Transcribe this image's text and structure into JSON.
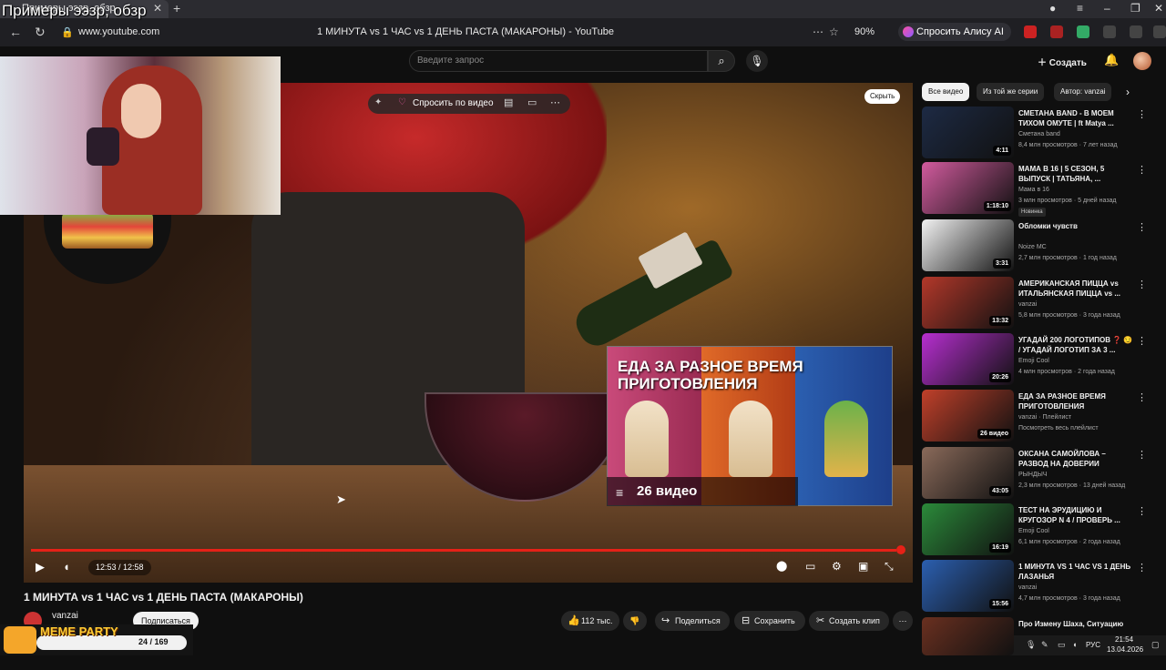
{
  "overlay_text": "Примеры ээзр, обзр",
  "browser": {
    "tab_title": "Примеры ээзр, обзр",
    "url": "www.youtube.com",
    "page_title": "1 МИНУТА vs 1 ЧАС vs 1 ДЕНЬ ПАСТА (МАКАРОНЫ) - YouTube",
    "zoom": "90%",
    "alice_label": "Спросить Алису AI"
  },
  "header": {
    "search_placeholder": "Введите запрос",
    "create_label": "Создать"
  },
  "player": {
    "ai_label": "Спросить по видео",
    "hide_label": "Скрыть",
    "time": "12:53 / 12:58",
    "progress": 0.994,
    "endcard": {
      "title": "ЕДА ЗА РАЗНОЕ ВРЕМЯ ПРИГОТОВЛЕНИЯ",
      "count": "26 видео"
    }
  },
  "video": {
    "title": "1 МИНУТА vs 1 ЧАС vs 1 ДЕНЬ ПАСТА (МАКАРОНЫ)",
    "channel": "vanzai",
    "subscribe_label": "Подписаться",
    "likes": "112 тыс.",
    "share_label": "Поделиться",
    "save_label": "Сохранить",
    "clip_label": "Создать клип"
  },
  "meme_widget": {
    "title": "MEME PARTY",
    "count": "24 / 169"
  },
  "sidebar": {
    "chips": [
      "Все видео",
      "Из той же серии",
      "Автор: vanzai"
    ],
    "items": [
      {
        "title": "СМЕТАНА BAND - В МОЕМ ТИХОМ ОМУТЕ | ft Matya ...",
        "channel": "Сметана band",
        "meta": "8,4 млн просмотров · 7 лет назад",
        "duration": "4:11",
        "badge": "",
        "thumb_color": "#1d2a44"
      },
      {
        "title": "МАМА В 16 | 5 СЕЗОН, 5 ВЫПУСК | ТАТЬЯНА, ...",
        "channel": "Мама в 16",
        "meta": "3 млн просмотров · 5 дней назад",
        "duration": "1:18:10",
        "badge": "Новинка",
        "thumb_color": "#d25b9e"
      },
      {
        "title": "Обломки чувств",
        "channel": "Noize MC",
        "meta": "2,7 млн просмотров · 1 год назад",
        "duration": "3:31",
        "badge": "",
        "thumb_color": "#f2f2f2"
      },
      {
        "title": "АМЕРИКАНСКАЯ ПИЦЦА vs ИТАЛЬЯНСКАЯ ПИЦЦА vs ...",
        "channel": "vanzai",
        "meta": "5,8 млн просмотров · 3 года назад",
        "duration": "13:32",
        "badge": "",
        "thumb_color": "#b3382a"
      },
      {
        "title": "УГАДАЙ 200 ЛОГОТИПОВ ❓ 😏 / УГАДАЙ ЛОГОТИП ЗА 3 ...",
        "channel": "Emoji Cool",
        "meta": "4 млн просмотров · 2 года назад",
        "duration": "20:26",
        "badge": "",
        "thumb_color": "#b72fd0"
      },
      {
        "title": "ЕДА ЗА РАЗНОЕ ВРЕМЯ ПРИГОТОВЛЕНИЯ",
        "channel": "vanzai · Плейлист",
        "meta": "Посмотреть весь плейлист",
        "duration": "26 видео",
        "badge": "",
        "thumb_color": "#c0402a"
      },
      {
        "title": "ОКСАНА САМОЙЛОВА – РАЗВОД НА ДОВЕРИИ",
        "channel": "РЫНДЫЧ",
        "meta": "2,3 млн просмотров · 13 дней назад",
        "duration": "43:05",
        "badge": "",
        "thumb_color": "#8a6a5a"
      },
      {
        "title": "ТЕСТ НА ЭРУДИЦИЮ И КРУГОЗОР N 4 / ПРОВЕРЬ ...",
        "channel": "Emoji Cool",
        "meta": "6,1 млн просмотров · 2 года назад",
        "duration": "16:19",
        "badge": "",
        "thumb_color": "#2b8a3a"
      },
      {
        "title": "1 МИНУТА VS 1 ЧАС VS 1 ДЕНЬ ЛАЗАНЬЯ",
        "channel": "vanzai",
        "meta": "4,7 млн просмотров · 3 года назад",
        "duration": "15:56",
        "badge": "",
        "thumb_color": "#2b5fb0"
      },
      {
        "title": "Про Измену Шаха, Ситуацию",
        "channel": "",
        "meta": "",
        "duration": "",
        "badge": "",
        "thumb_color": "#6a3020"
      }
    ]
  },
  "taskbar": {
    "lang": "РУС",
    "time": "21:54",
    "date": "13.04.2026"
  }
}
